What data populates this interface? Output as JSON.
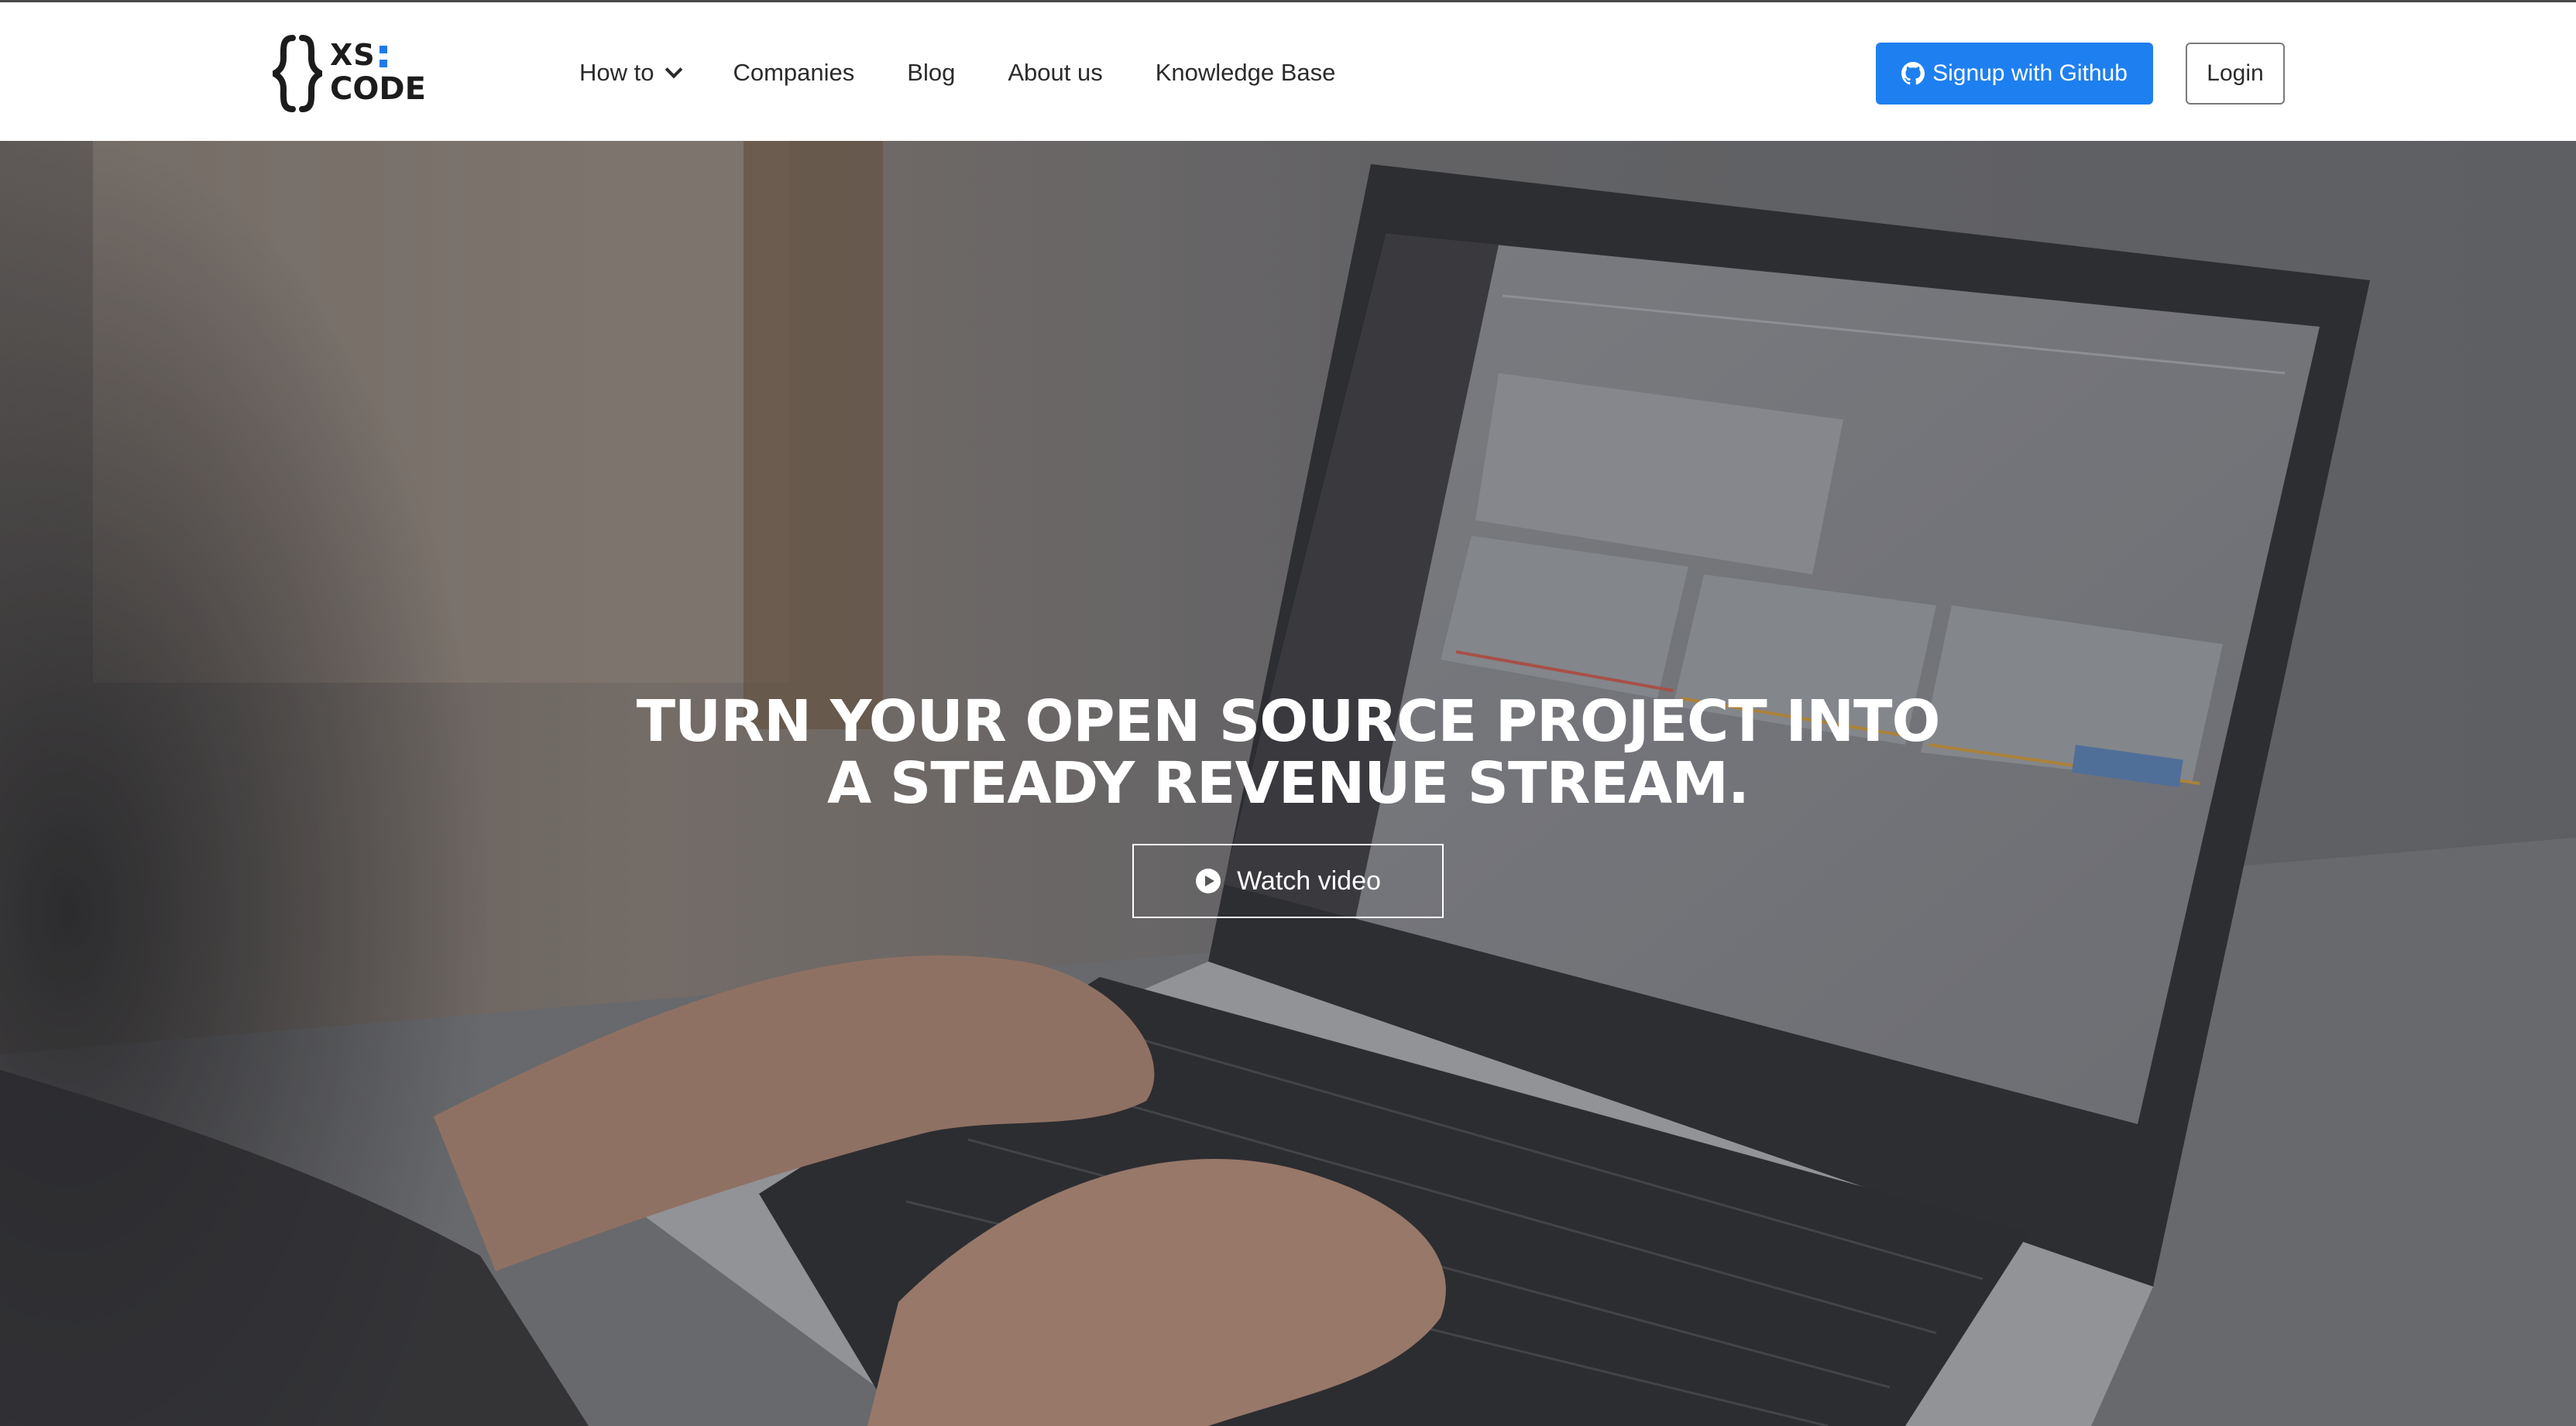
{
  "brand": {
    "logo_line1": "XS",
    "logo_line2": "CODE",
    "accent_color": "#1f7bea"
  },
  "nav": {
    "items": [
      {
        "label": "How to",
        "has_dropdown": true
      },
      {
        "label": "Companies",
        "has_dropdown": false
      },
      {
        "label": "Blog",
        "has_dropdown": false
      },
      {
        "label": "About us",
        "has_dropdown": false
      },
      {
        "label": "Knowledge Base",
        "has_dropdown": false
      }
    ],
    "signup_label": "Signup with Github",
    "signup_icon": "github-icon",
    "signup_color": "#1e7ff0",
    "login_label": "Login"
  },
  "hero": {
    "title_line1": "TURN YOUR OPEN SOURCE PROJECT INTO",
    "title_line2": "A STEADY REVENUE STREAM.",
    "cta_label": "Watch video",
    "cta_icon": "play-circle-icon",
    "background": "photo of hands typing on a laptop showing the XS:CODE dashboard"
  }
}
